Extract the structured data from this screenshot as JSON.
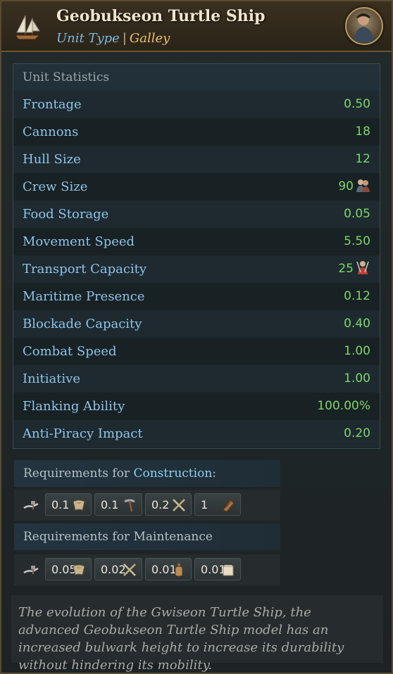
{
  "header": {
    "title": "Geobukseon Turtle Ship",
    "unit_type_label": "Unit Type",
    "separator": "|",
    "category": "Galley",
    "icons": {
      "ship": "sailing-ship-icon",
      "portrait": "commander-portrait"
    }
  },
  "stats": {
    "heading": "Unit Statistics",
    "rows": [
      {
        "label": "Frontage",
        "value": "0.50"
      },
      {
        "label": "Cannons",
        "value": "18"
      },
      {
        "label": "Hull Size",
        "value": "12"
      },
      {
        "label": "Crew Size",
        "value": "90",
        "icon": "crew-icon"
      },
      {
        "label": "Food Storage",
        "value": "0.05"
      },
      {
        "label": "Movement Speed",
        "value": "5.50"
      },
      {
        "label": "Transport Capacity",
        "value": "25",
        "icon": "soldier-icon"
      },
      {
        "label": "Maritime Presence",
        "value": "0.12"
      },
      {
        "label": "Blockade Capacity",
        "value": "0.40"
      },
      {
        "label": "Combat Speed",
        "value": "1.00"
      },
      {
        "label": "Initiative",
        "value": "1.00"
      },
      {
        "label": "Flanking Ability",
        "value": "100.00%"
      },
      {
        "label": "Anti-Piracy Impact",
        "value": "0.20"
      }
    ]
  },
  "construction": {
    "heading_prefix": "Requirements for",
    "heading_highlight": "Construction",
    "heading_suffix": ":",
    "items": [
      {
        "value": "0.1",
        "icon": "sail-cloth-icon"
      },
      {
        "value": "0.1",
        "icon": "tools-icon"
      },
      {
        "value": "0.2",
        "icon": "weapons-icon"
      },
      {
        "value": "1",
        "icon": "lumber-icon"
      }
    ]
  },
  "maintenance": {
    "heading": "Requirements for Maintenance",
    "items": [
      {
        "value": "0.05",
        "icon": "sail-cloth-icon"
      },
      {
        "value": "0.02",
        "icon": "weapons-icon"
      },
      {
        "value": "0.01",
        "icon": "liquor-icon"
      },
      {
        "value": "0.01",
        "icon": "paper-icon"
      }
    ]
  },
  "description": "The evolution of the Gwiseon Turtle Ship, the advanced Geobukseon Turtle Ship model has an increased bulwark height to increase its durability without hindering its mobility.",
  "colors": {
    "label": "#8fc4e8",
    "value": "#7ed66a",
    "accent_type": "#7fb8e0",
    "accent_category": "#e8c070"
  }
}
